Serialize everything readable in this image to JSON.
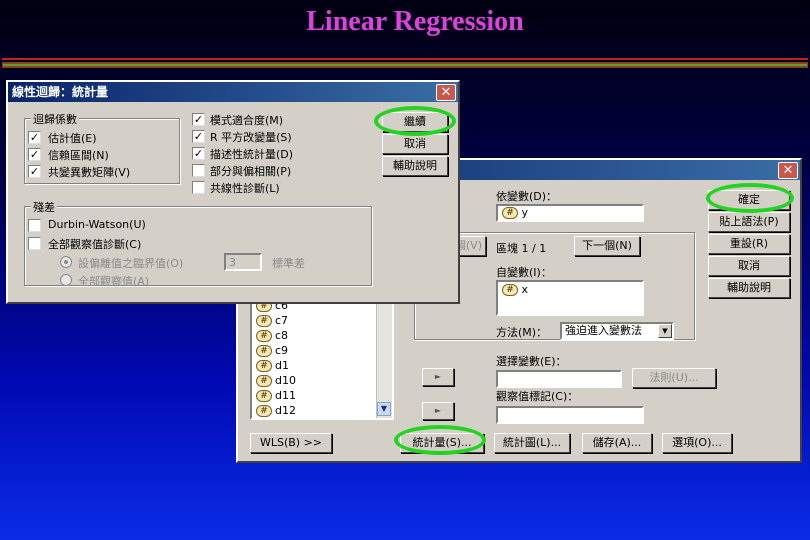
{
  "slide": {
    "title": "Linear Regression"
  },
  "main_dialog": {
    "close_glyph": "✕",
    "dependent": {
      "label": "依變數(D)：",
      "value": "y"
    },
    "block": {
      "prev_label": "前一個(V)",
      "label": "區塊 1 / 1",
      "next_label": "下一個(N)"
    },
    "independent": {
      "label": "自變數(I)：",
      "values": [
        "x"
      ]
    },
    "method": {
      "label": "方法(M)：",
      "value": "強迫進入變數法"
    },
    "selection": {
      "label": "選擇變數(E)：",
      "rule_label": "法則(U)..."
    },
    "case_labels": {
      "label": "觀察值標記(C)："
    },
    "variables": [
      "c6",
      "c7",
      "c8",
      "c9",
      "d1",
      "d10",
      "d11",
      "d12"
    ],
    "buttons": {
      "ok": "確定",
      "paste": "貼上語法(P)",
      "reset": "重設(R)",
      "cancel": "取消",
      "help": "輔助說明",
      "wls": "WLS(B) >>",
      "statistics": "統計量(S)...",
      "plots": "統計圖(L)...",
      "save": "儲存(A)...",
      "options": "選項(O)..."
    }
  },
  "stats_dialog": {
    "title": "線性迴歸：統計量",
    "close_glyph": "✕",
    "coefficients": {
      "title": "迴歸係數",
      "items": [
        {
          "label": "估計值(E)",
          "checked": true
        },
        {
          "label": "信賴區間(N)",
          "checked": true
        },
        {
          "label": "共變異數矩陣(V)",
          "checked": true
        }
      ]
    },
    "right_options": [
      {
        "label": "模式適合度(M)",
        "checked": true
      },
      {
        "label": "R 平方改變量(S)",
        "checked": true
      },
      {
        "label": "描述性統計量(D)",
        "checked": true
      },
      {
        "label": "部分與偏相關(P)",
        "checked": false
      },
      {
        "label": "共線性診斷(L)",
        "checked": false
      }
    ],
    "residuals": {
      "title": "殘差",
      "durbin": {
        "label": "Durbin-Watson(U)",
        "checked": false
      },
      "casewise": {
        "label": "全部觀察值診斷(C)",
        "checked": false
      },
      "outliers": {
        "label": "設偏離值之臨界值(O)",
        "value": "3",
        "unit": "標準差"
      },
      "all_cases": {
        "label": "全部觀察值(A)"
      }
    },
    "buttons": {
      "continue": "繼續",
      "cancel": "取消",
      "help": "輔助說明"
    }
  },
  "colors": {
    "highlight_ring": "#22d322",
    "title": "#e040e0"
  }
}
